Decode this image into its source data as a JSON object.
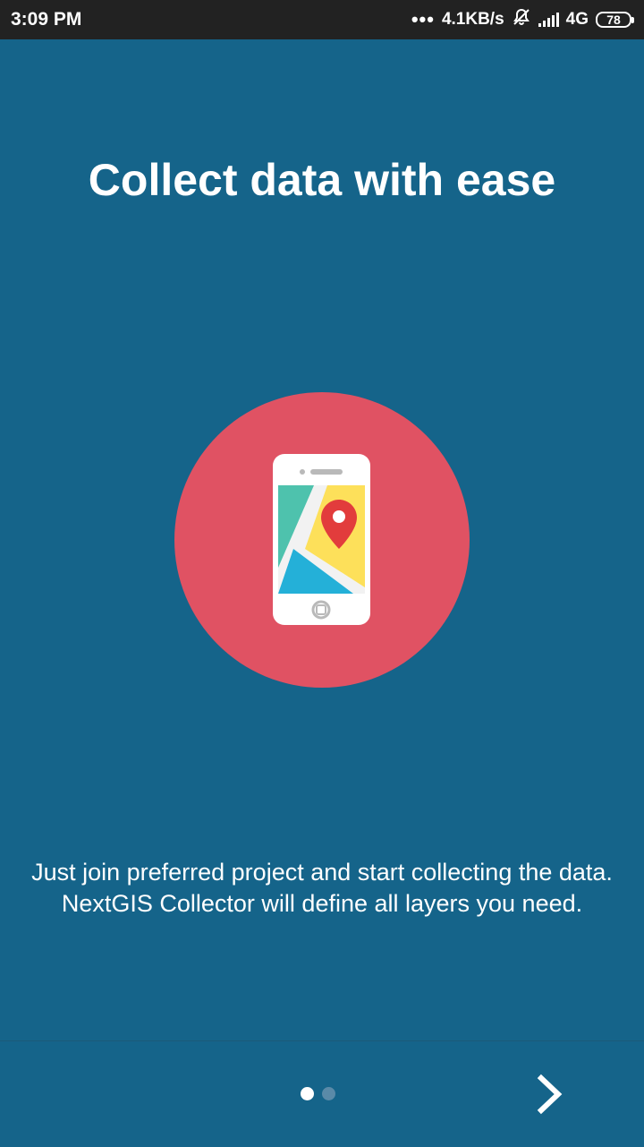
{
  "status_bar": {
    "time": "3:09 PM",
    "network_speed": "4.1KB/s",
    "network_type": "4G",
    "battery_level": "78",
    "icons": [
      "more-dots-icon",
      "notifications-muted-icon",
      "signal-icon",
      "battery-icon"
    ]
  },
  "onboarding": {
    "title": "Collect data with ease",
    "description": "Just join preferred project and start collecting the data. NextGIS Collector will define all layers you need.",
    "illustration": "phone-map-pin-icon",
    "page_indicator": {
      "current": 1,
      "total": 2
    },
    "next_icon": "chevron-right-icon"
  },
  "colors": {
    "background": "#15648a",
    "status_bar": "#222222",
    "circle": "#e05263",
    "indicator_active": "#ffffff",
    "indicator_inactive": "#5a8aa8"
  }
}
